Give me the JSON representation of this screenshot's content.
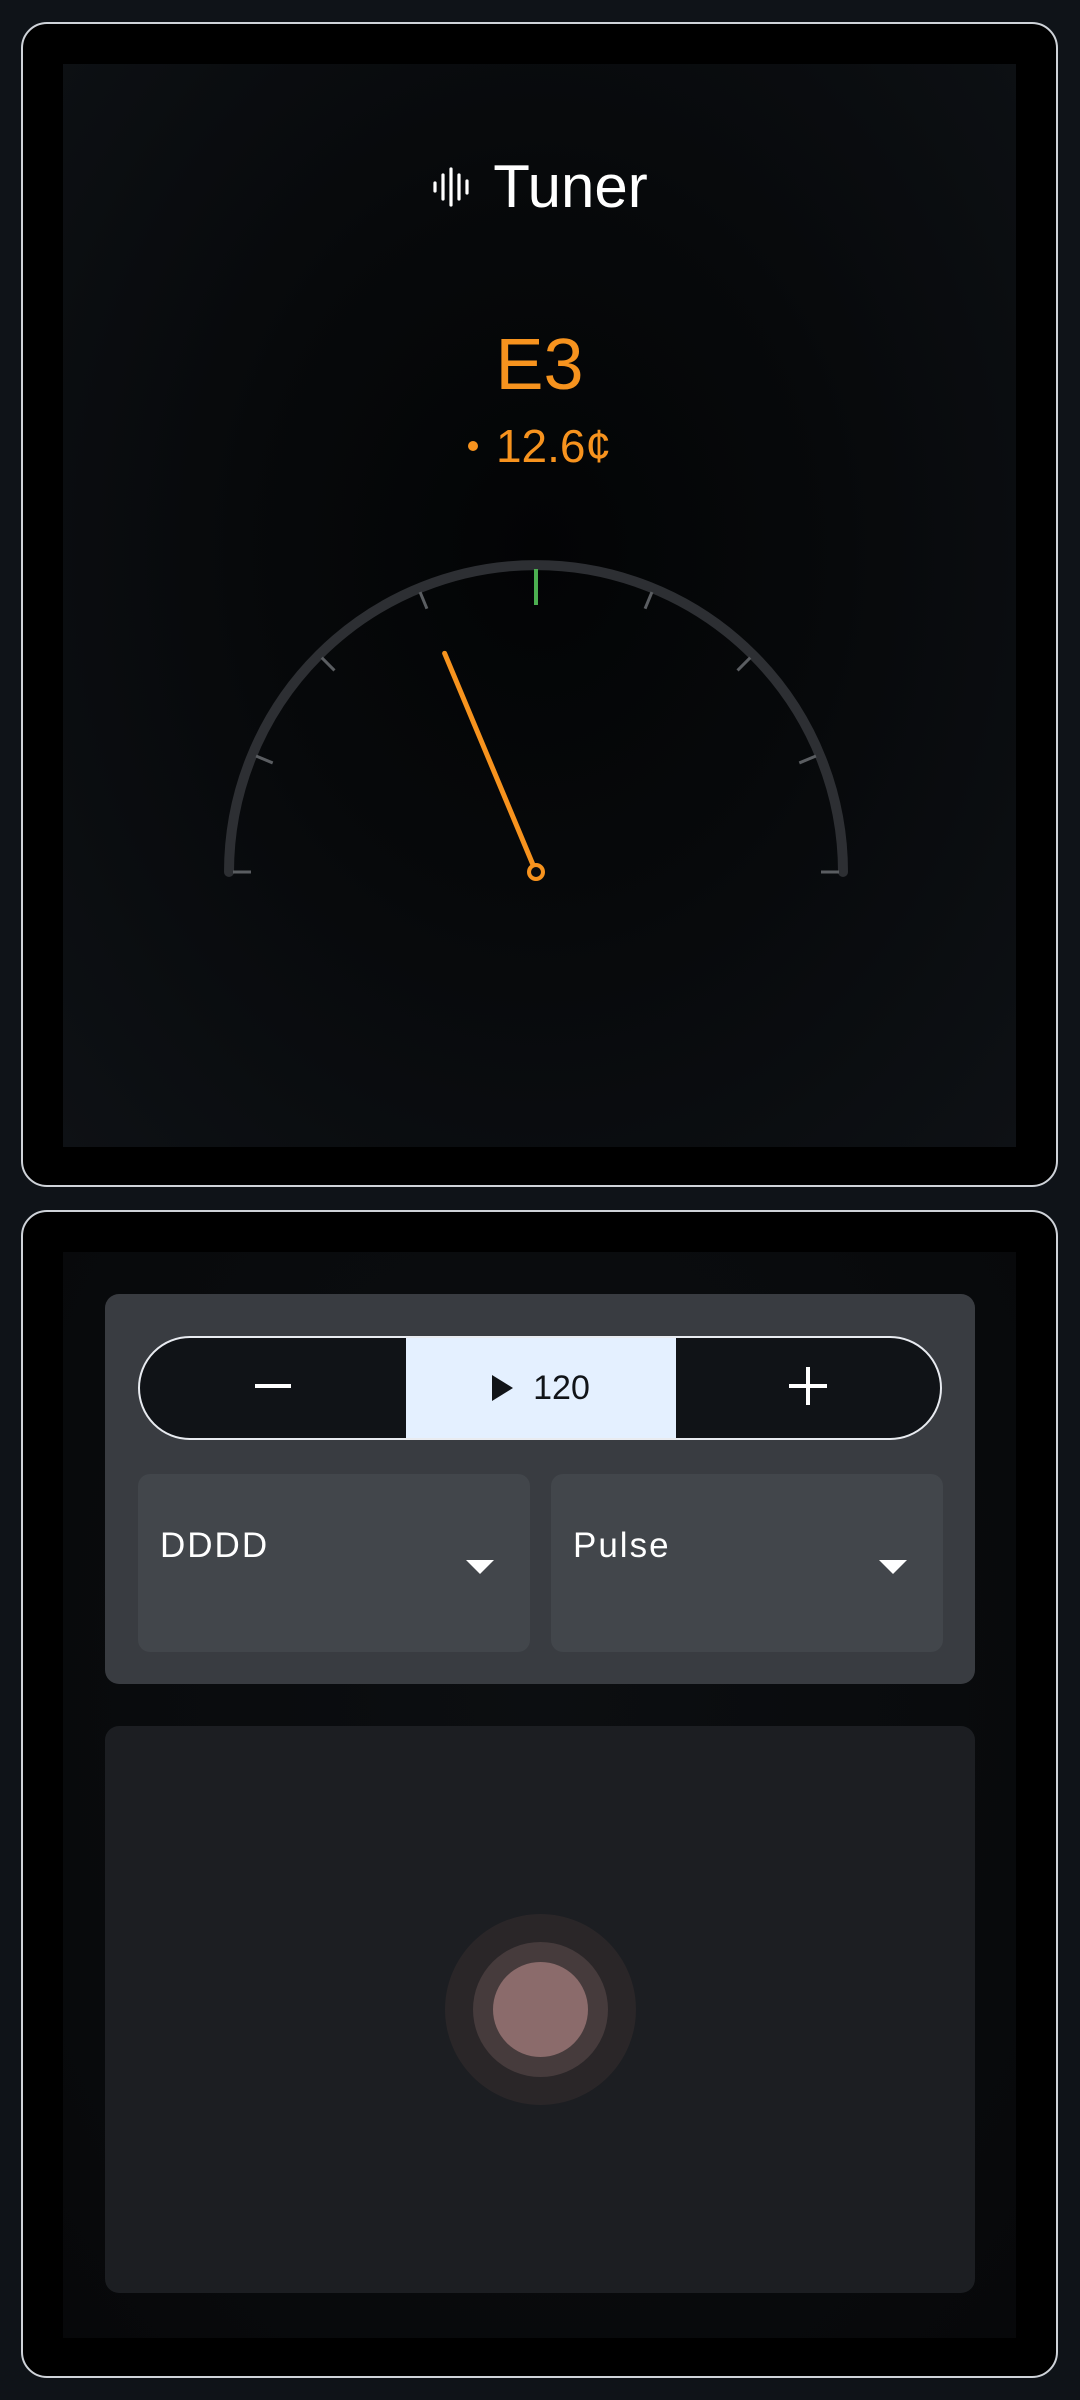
{
  "tuner": {
    "title": "Tuner",
    "title_icon": "waveform-icon",
    "note": "E3",
    "cents_text": "12.6¢",
    "cents_value": 12.6,
    "gauge": {
      "min_cents": -50,
      "max_cents": 50,
      "needle_cents": -12.6,
      "in_tune_color": "#4caf50",
      "needle_color": "#f7931e",
      "tick_color": "#5a5d61"
    },
    "accent_color": "#f7931e"
  },
  "metronome": {
    "minus_icon": "minus-icon",
    "play_icon": "play-icon",
    "bpm": "120",
    "plus_icon": "plus-icon",
    "pattern_value": "DDDD",
    "sound_value": "Pulse",
    "tap_pad_icon": "beat-indicator-icon"
  }
}
